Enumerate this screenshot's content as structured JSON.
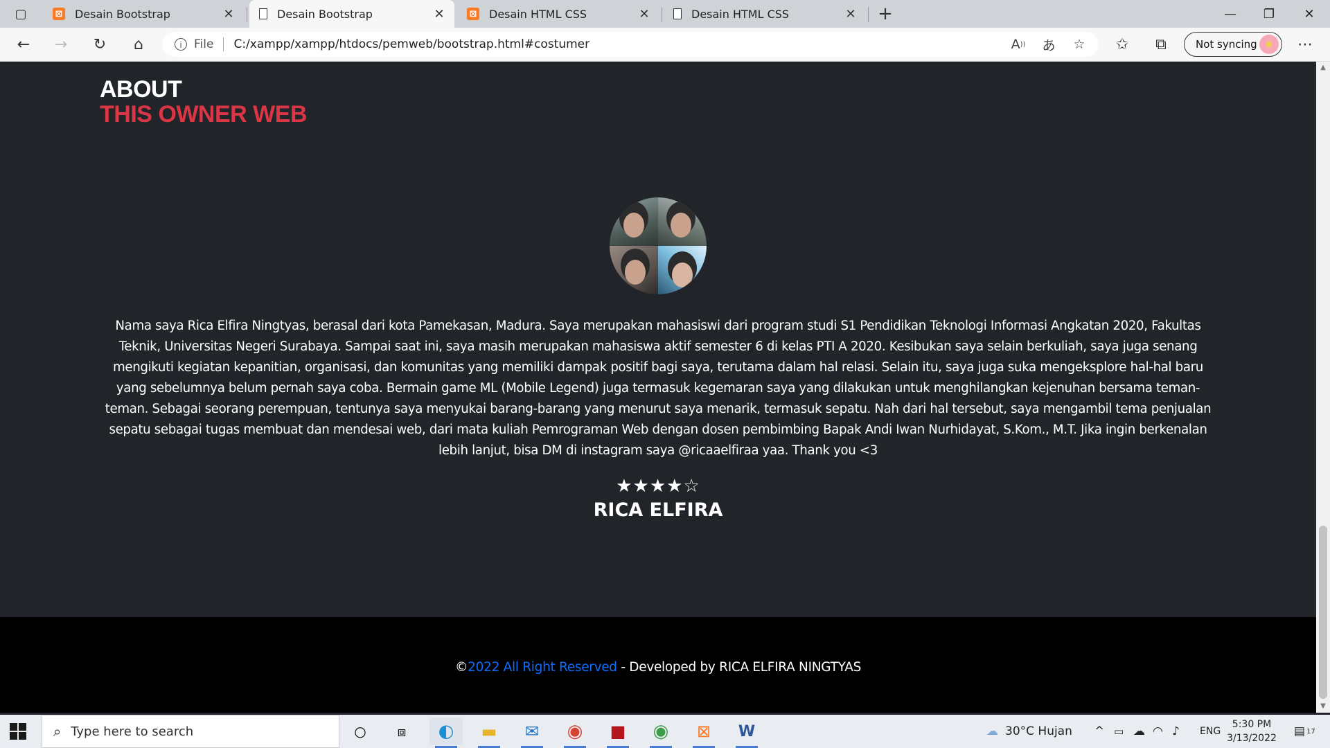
{
  "browser": {
    "tabs": [
      {
        "title": "Desain Bootstrap",
        "favicon": "xampp-icon",
        "active": false
      },
      {
        "title": "Desain Bootstrap",
        "favicon": "file-icon",
        "active": true
      },
      {
        "title": "Desain HTML CSS",
        "favicon": "xampp-icon",
        "active": false
      },
      {
        "title": "Desain HTML CSS",
        "favicon": "file-icon",
        "active": false
      }
    ],
    "address": {
      "scheme_label": "File",
      "url": "C:/xampp/xampp/htdocs/pemweb/bootstrap.html#costumer"
    },
    "sync_label": "Not syncing"
  },
  "page": {
    "about_title": "ABOUT",
    "about_subtitle": "THIS OWNER WEB",
    "bio": "Nama saya Rica Elfira Ningtyas, berasal dari kota Pamekasan, Madura. Saya merupakan mahasiswi dari program studi S1 Pendidikan Teknologi Informasi Angkatan 2020, Fakultas Teknik, Universitas Negeri Surabaya. Sampai saat ini, saya masih merupakan mahasiswa aktif semester 6 di kelas PTI A 2020. Kesibukan saya selain berkuliah, saya juga senang mengikuti kegiatan kepanitian, organisasi, dan komunitas yang memiliki dampak positif bagi saya, terutama dalam hal relasi. Selain itu, saya juga suka mengeksplore hal-hal baru yang sebelumnya belum pernah saya coba. Bermain game ML (Mobile Legend) juga termasuk kegemaran saya yang dilakukan untuk menghilangkan kejenuhan bersama teman-teman. Sebagai seorang perempuan, tentunya saya menyukai barang-barang yang menurut saya menarik, termasuk sepatu. Nah dari hal tersebut, saya mengambil tema penjualan sepatu sebagai tugas membuat dan mendesai web, dari mata kuliah Pemrograman Web dengan dosen pembimbing Bapak Andi Iwan Nurhidayat, S.Kom., M.T. Jika ingin berkenalan lebih lanjut, bisa DM di instagram saya @ricaaelfiraa yaa. Thank you <3",
    "rating": {
      "filled": 4,
      "total": 5
    },
    "owner_name": "RICA ELFIRA",
    "footer": {
      "copyright_symbol": "©",
      "link_text": "2022 All Right Reserved",
      "developer_text": " - Developed by RICA ELFIRA NINGTYAS"
    },
    "colors": {
      "background": "#212529",
      "accent": "#dc3545",
      "footer_bg": "#000000",
      "link": "#0d6efd"
    }
  },
  "taskbar": {
    "search_placeholder": "Type here to search",
    "apps": [
      "cortana-icon",
      "task-view-icon",
      "edge-icon",
      "file-explorer-icon",
      "mail-icon",
      "chrome-icon",
      "filezilla-icon",
      "chrome-profile-icon",
      "xampp-icon",
      "word-icon"
    ],
    "weather": "30°C  Hujan",
    "language": "ENG",
    "time": "5:30 PM",
    "date": "3/13/2022",
    "notification_count": "17"
  }
}
